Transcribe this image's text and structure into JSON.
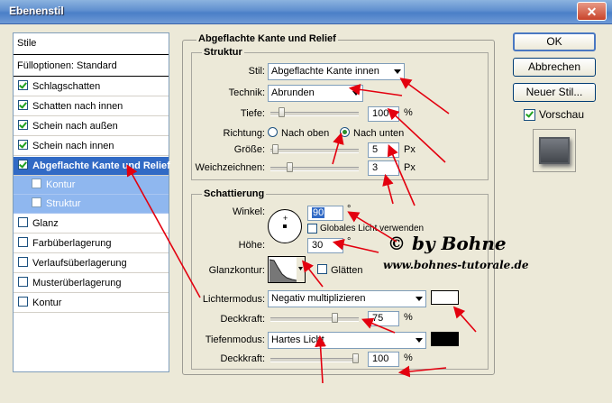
{
  "window": {
    "title": "Ebenenstil",
    "close_glyph": "✕"
  },
  "sidebar": {
    "items": [
      {
        "label": "Stile",
        "checkbox": false
      },
      {
        "label": "Fülloptionen: Standard",
        "checkbox": false
      },
      {
        "label": "Schlagschatten",
        "checkbox": true,
        "checked": true
      },
      {
        "label": "Schatten nach innen",
        "checkbox": true,
        "checked": true
      },
      {
        "label": "Schein nach außen",
        "checkbox": true,
        "checked": true
      },
      {
        "label": "Schein nach innen",
        "checkbox": true,
        "checked": true
      },
      {
        "label": "Abgeflachte Kante und Relief",
        "checkbox": true,
        "checked": true,
        "selected": true
      },
      {
        "label": "Kontur",
        "checkbox": true,
        "checked": false,
        "sub": true
      },
      {
        "label": "Struktur",
        "checkbox": true,
        "checked": false,
        "sub": true
      },
      {
        "label": "Glanz",
        "checkbox": true,
        "checked": false
      },
      {
        "label": "Farbüberlagerung",
        "checkbox": true,
        "checked": false
      },
      {
        "label": "Verlaufsüberlagerung",
        "checkbox": true,
        "checked": false
      },
      {
        "label": "Musterüberlagerung",
        "checkbox": true,
        "checked": false
      },
      {
        "label": "Kontur",
        "checkbox": true,
        "checked": false
      }
    ]
  },
  "panel": {
    "title": "Abgeflachte Kante und Relief",
    "struktur": {
      "title": "Struktur",
      "stil_label": "Stil:",
      "stil_value": "Abgeflachte Kante innen",
      "technik_label": "Technik:",
      "technik_value": "Abrunden",
      "tiefe_label": "Tiefe:",
      "tiefe_value": "100",
      "tiefe_unit": "%",
      "tiefe_level": 0.1,
      "richtung_label": "Richtung:",
      "richtung_oben": "Nach oben",
      "richtung_unten": "Nach unten",
      "richtung_selected": "unten",
      "groesse_label": "Größe:",
      "groesse_value": "5",
      "groesse_unit": "Px",
      "groesse_level": 0.02,
      "weich_label": "Weichzeichnen:",
      "weich_value": "3",
      "weich_unit": "Px",
      "weich_level": 0.2
    },
    "schattierung": {
      "title": "Schattierung",
      "winkel_label": "Winkel:",
      "winkel_value": "90",
      "winkel_unit": "°",
      "global_label": "Globales Licht verwenden",
      "global_checked": false,
      "hoehe_label": "Höhe:",
      "hoehe_value": "30",
      "hoehe_unit": "°",
      "glanzkontur_label": "Glanzkontur:",
      "glaetten_label": "Glätten",
      "glaetten_checked": false,
      "lichtermodus_label": "Lichtermodus:",
      "lichtermodus_value": "Negativ multiplizieren",
      "lichter_color": "#ffffff",
      "deckkraft1_label": "Deckkraft:",
      "deckkraft1_value": "75",
      "deckkraft1_unit": "%",
      "deckkraft1_level": 0.75,
      "tiefenmodus_label": "Tiefenmodus:",
      "tiefenmodus_value": "Hartes Licht",
      "tiefen_color": "#000000",
      "deckkraft2_label": "Deckkraft:",
      "deckkraft2_value": "100",
      "deckkraft2_unit": "%",
      "deckkraft2_level": 1.0
    }
  },
  "buttons": {
    "ok": "OK",
    "cancel": "Abbrechen",
    "new_style": "Neuer Stil...",
    "preview_label": "Vorschau",
    "preview_checked": true
  },
  "watermark": {
    "line1": "© by Bohne",
    "line2": "www.bohnes-tutorale.de"
  },
  "colors": {
    "accent": "#316ac5",
    "sub_selected": "#8fb7ef",
    "annotation": "#e3000f"
  }
}
